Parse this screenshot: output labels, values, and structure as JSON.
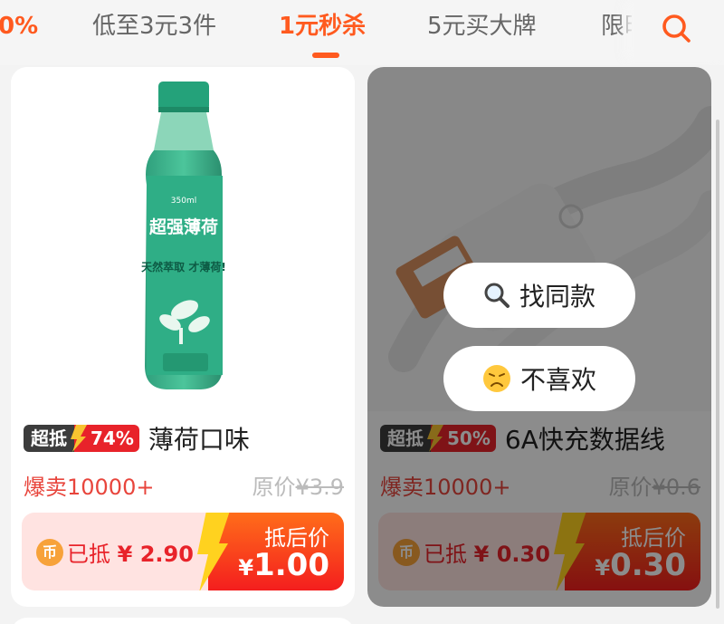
{
  "tabs": {
    "items": [
      {
        "label": "0%"
      },
      {
        "label": "低至3元3件"
      },
      {
        "label": "1元秒杀"
      },
      {
        "label": "5元买大牌"
      },
      {
        "label": "限时"
      }
    ],
    "active_index": 2,
    "search_icon": "search-icon"
  },
  "products": [
    {
      "badge_text": "超抵",
      "badge_percent": "74%",
      "title": "薄荷口味",
      "sales": "爆卖10000+",
      "orig_label": "原价",
      "orig_price": "¥3.9",
      "coin_icon": "币",
      "deducted_label": "已抵",
      "deducted_value": "¥ 2.90",
      "final_label": "抵后价",
      "final_currency": "¥",
      "final_price": "1.00",
      "bottle_text": {
        "title": "超强薄荷",
        "slogan": "天然萃取 才薄荷!",
        "volume": "350ml"
      }
    },
    {
      "badge_text": "超抵",
      "badge_percent": "50%",
      "title": "6A快充数据线",
      "sales": "爆卖10000+",
      "orig_label": "原价",
      "orig_price": "¥0.6",
      "coin_icon": "币",
      "deducted_label": "已抵",
      "deducted_value": "¥ 0.30",
      "final_label": "抵后价",
      "final_currency": "¥",
      "final_price": "0.30"
    }
  ],
  "overlay_menu": {
    "find_similar": {
      "icon": "magnifier-icon",
      "label": "找同款"
    },
    "dislike": {
      "icon": "frown-face-icon",
      "label": "不喜欢"
    }
  },
  "colors": {
    "accent": "#ff5a1f",
    "price_red": "#e8232a",
    "sales_red": "#e8453c",
    "coin_orange": "#f7a23a"
  }
}
